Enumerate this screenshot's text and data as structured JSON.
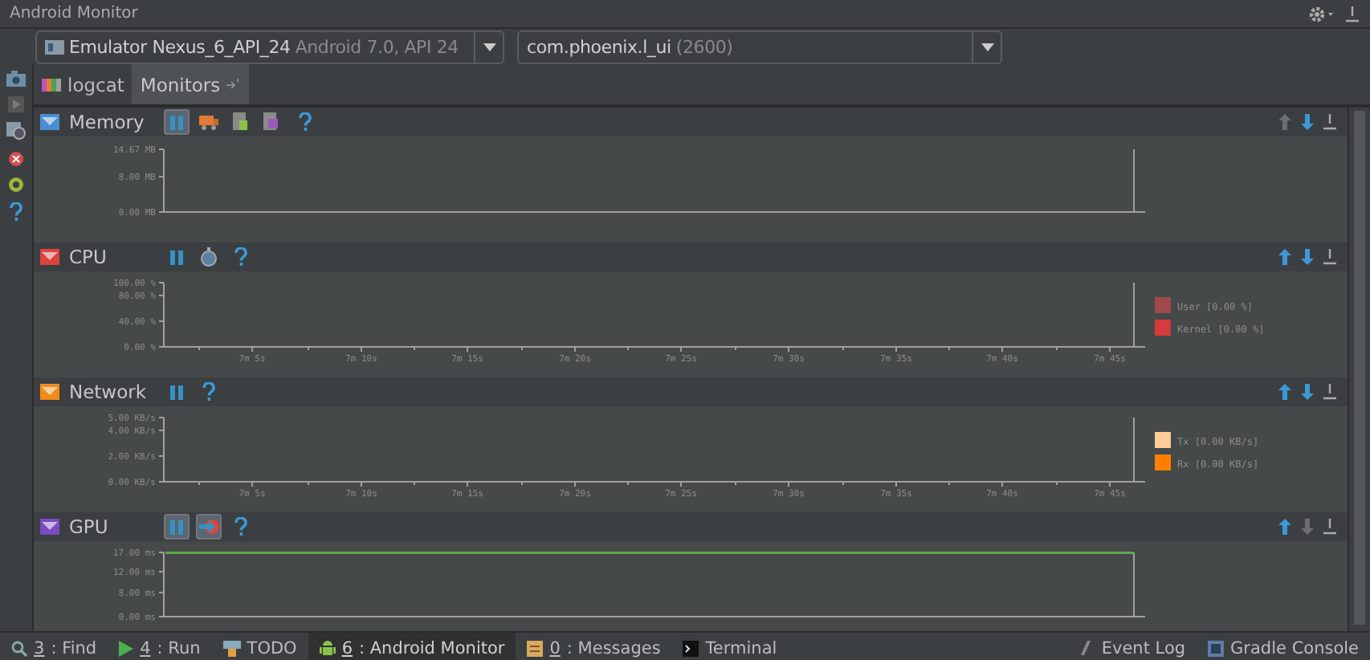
{
  "window": {
    "title": "Android Monitor"
  },
  "device": {
    "name": "Emulator Nexus_6_API_24",
    "detail": "Android 7.0, API 24"
  },
  "process": {
    "name": "com.phoenix.l_ui",
    "pid": "(2600)"
  },
  "tabs": [
    {
      "label": "logcat",
      "kind": "logcat",
      "selected": false
    },
    {
      "label": "Monitors",
      "kind": "monitors",
      "selected": true
    }
  ],
  "monitors": [
    {
      "title": "Memory",
      "color": "#4a8fd0",
      "buttons": [
        {
          "kind": "pause",
          "pressed": true
        },
        {
          "kind": "gc",
          "pressed": false
        },
        {
          "kind": "heap",
          "pressed": false
        },
        {
          "kind": "alloc",
          "pressed": false
        },
        {
          "kind": "help",
          "pressed": false
        }
      ],
      "up_disabled": true,
      "down_disabled": false,
      "y_ticks": [
        "14.67 MB",
        "8.00 MB",
        "0.00 MB"
      ]
    },
    {
      "title": "CPU",
      "color": "#d9443c",
      "buttons": [
        {
          "kind": "pause",
          "pressed": false
        },
        {
          "kind": "trace",
          "pressed": false
        },
        {
          "kind": "help",
          "pressed": false
        }
      ],
      "up_disabled": false,
      "down_disabled": false,
      "y_ticks": [
        "100.00 %",
        "80.00 %",
        "40.00 %",
        "0.00 %"
      ],
      "x_ticks": [
        "7m 5s",
        "7m 10s",
        "7m 15s",
        "7m 20s",
        "7m 25s",
        "7m 30s",
        "7m 35s",
        "7m 40s",
        "7m 45s"
      ],
      "legend": [
        {
          "label": "User [0.00 %]",
          "color": "#9e4a4a"
        },
        {
          "label": "Kernel [0.00 %]",
          "color": "#d63a3a"
        }
      ]
    },
    {
      "title": "Network",
      "color": "#f28b1a",
      "buttons": [
        {
          "kind": "pause",
          "pressed": false
        },
        {
          "kind": "help",
          "pressed": false
        }
      ],
      "up_disabled": false,
      "down_disabled": false,
      "y_ticks": [
        "5.00 KB/s",
        "4.00 KB/s",
        "2.00 KB/s",
        "0.00 KB/s"
      ],
      "x_ticks": [
        "7m 5s",
        "7m 10s",
        "7m 15s",
        "7m 20s",
        "7m 25s",
        "7m 30s",
        "7m 35s",
        "7m 40s",
        "7m 45s"
      ],
      "legend": [
        {
          "label": "Tx [0.00 KB/s]",
          "color": "#ffcc99"
        },
        {
          "label": "Rx [0.00 KB/s]",
          "color": "#ff8000"
        }
      ]
    },
    {
      "title": "GPU",
      "color": "#7a4ac0",
      "buttons": [
        {
          "kind": "pause",
          "pressed": true
        },
        {
          "kind": "gpu",
          "pressed": true
        },
        {
          "kind": "help",
          "pressed": false
        }
      ],
      "up_disabled": false,
      "down_disabled": true,
      "y_ticks": [
        "17.00 ms",
        "12.00 ms",
        "8.00 ms",
        "0.00 ms"
      ],
      "threshold": true
    }
  ],
  "bottom_bar": {
    "left": [
      {
        "kind": "find",
        "key": "3",
        "text": ": Find",
        "selected": false
      },
      {
        "kind": "run",
        "key": "4",
        "text": ": Run",
        "selected": false
      },
      {
        "kind": "todo",
        "text": "TODO",
        "selected": false
      },
      {
        "kind": "android",
        "key": "6",
        "text": ": Android Monitor",
        "selected": true
      },
      {
        "kind": "messages",
        "key": "0",
        "text": ": Messages",
        "selected": false
      },
      {
        "kind": "terminal",
        "text": "Terminal",
        "selected": false
      }
    ],
    "right": [
      {
        "kind": "event",
        "text": "Event Log"
      },
      {
        "kind": "gradle",
        "text": "Gradle Console"
      }
    ]
  }
}
